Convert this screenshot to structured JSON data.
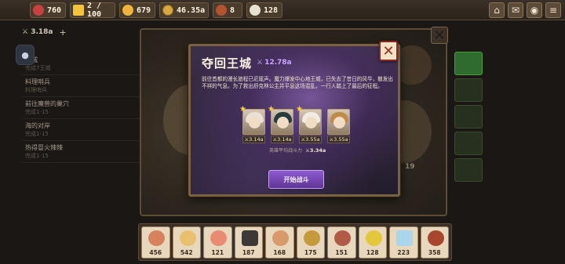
{
  "resources": [
    {
      "icon": "ruby-icon",
      "value": "760",
      "color": "#c94040"
    },
    {
      "icon": "energy-icon",
      "value": "2 / 100",
      "color": "#f3c33b"
    },
    {
      "icon": "muscle-icon",
      "value": "679",
      "color": "#f0b43a"
    },
    {
      "icon": "coin-icon",
      "value": "46.35a",
      "color": "#d9a63f"
    },
    {
      "icon": "meat-icon",
      "value": "8",
      "color": "#b2522e"
    },
    {
      "icon": "chef-hat-icon",
      "value": "128",
      "color": "#e8e1d2"
    }
  ],
  "top_buttons": [
    "home-icon",
    "mail-icon",
    "camera-icon",
    "menu-icon"
  ],
  "quest_panel": {
    "power": "3.18a",
    "items": [
      {
        "title": "王城",
        "sub": "完成7王城"
      },
      {
        "title": "料理哨兵",
        "sub": "料理哨兵"
      },
      {
        "title": "前往魔兽的巢穴",
        "sub": "完成1-15"
      },
      {
        "title": "海的对岸",
        "sub": "完成1-15"
      },
      {
        "title": "热得冒火辣辣",
        "sub": "完成1-15"
      }
    ]
  },
  "map": {
    "numbers": [
      "19"
    ]
  },
  "modal": {
    "title": "夺回王城",
    "power": "12.78a",
    "description": "前往首都的漫长旅程已近尾声。魔力爆发中心地王城，已失去了昔日的风华，散发出不祥的气息。为了救出舒克林公主并平息这场混乱，一行人踏上了最后的征程。",
    "heroes": [
      {
        "power": "3.14a",
        "star": true,
        "hair": "#e9e1d6"
      },
      {
        "power": "3.14a",
        "star": true,
        "hair": "#263b3a"
      },
      {
        "power": "3.55a",
        "star": true,
        "hair": "#f0ece4"
      },
      {
        "power": "3.55a",
        "star": false,
        "hair": "#c08a48"
      }
    ],
    "avg_label": "英雄平均战斗力",
    "avg_value": "3.34a",
    "start_button": "开始战斗",
    "close": "✕"
  },
  "foods": [
    {
      "count": "456",
      "color": "#d9805f"
    },
    {
      "count": "542",
      "color": "#e8c070"
    },
    {
      "count": "121",
      "color": "#e98a73"
    },
    {
      "count": "187",
      "color": "#3d3834"
    },
    {
      "count": "168",
      "color": "#d89a6a"
    },
    {
      "count": "175",
      "color": "#c49a3a"
    },
    {
      "count": "151",
      "color": "#b05a48"
    },
    {
      "count": "128",
      "color": "#e3c83c"
    },
    {
      "count": "223",
      "color": "#a9d6ec"
    },
    {
      "count": "358",
      "color": "#a9452c"
    }
  ]
}
